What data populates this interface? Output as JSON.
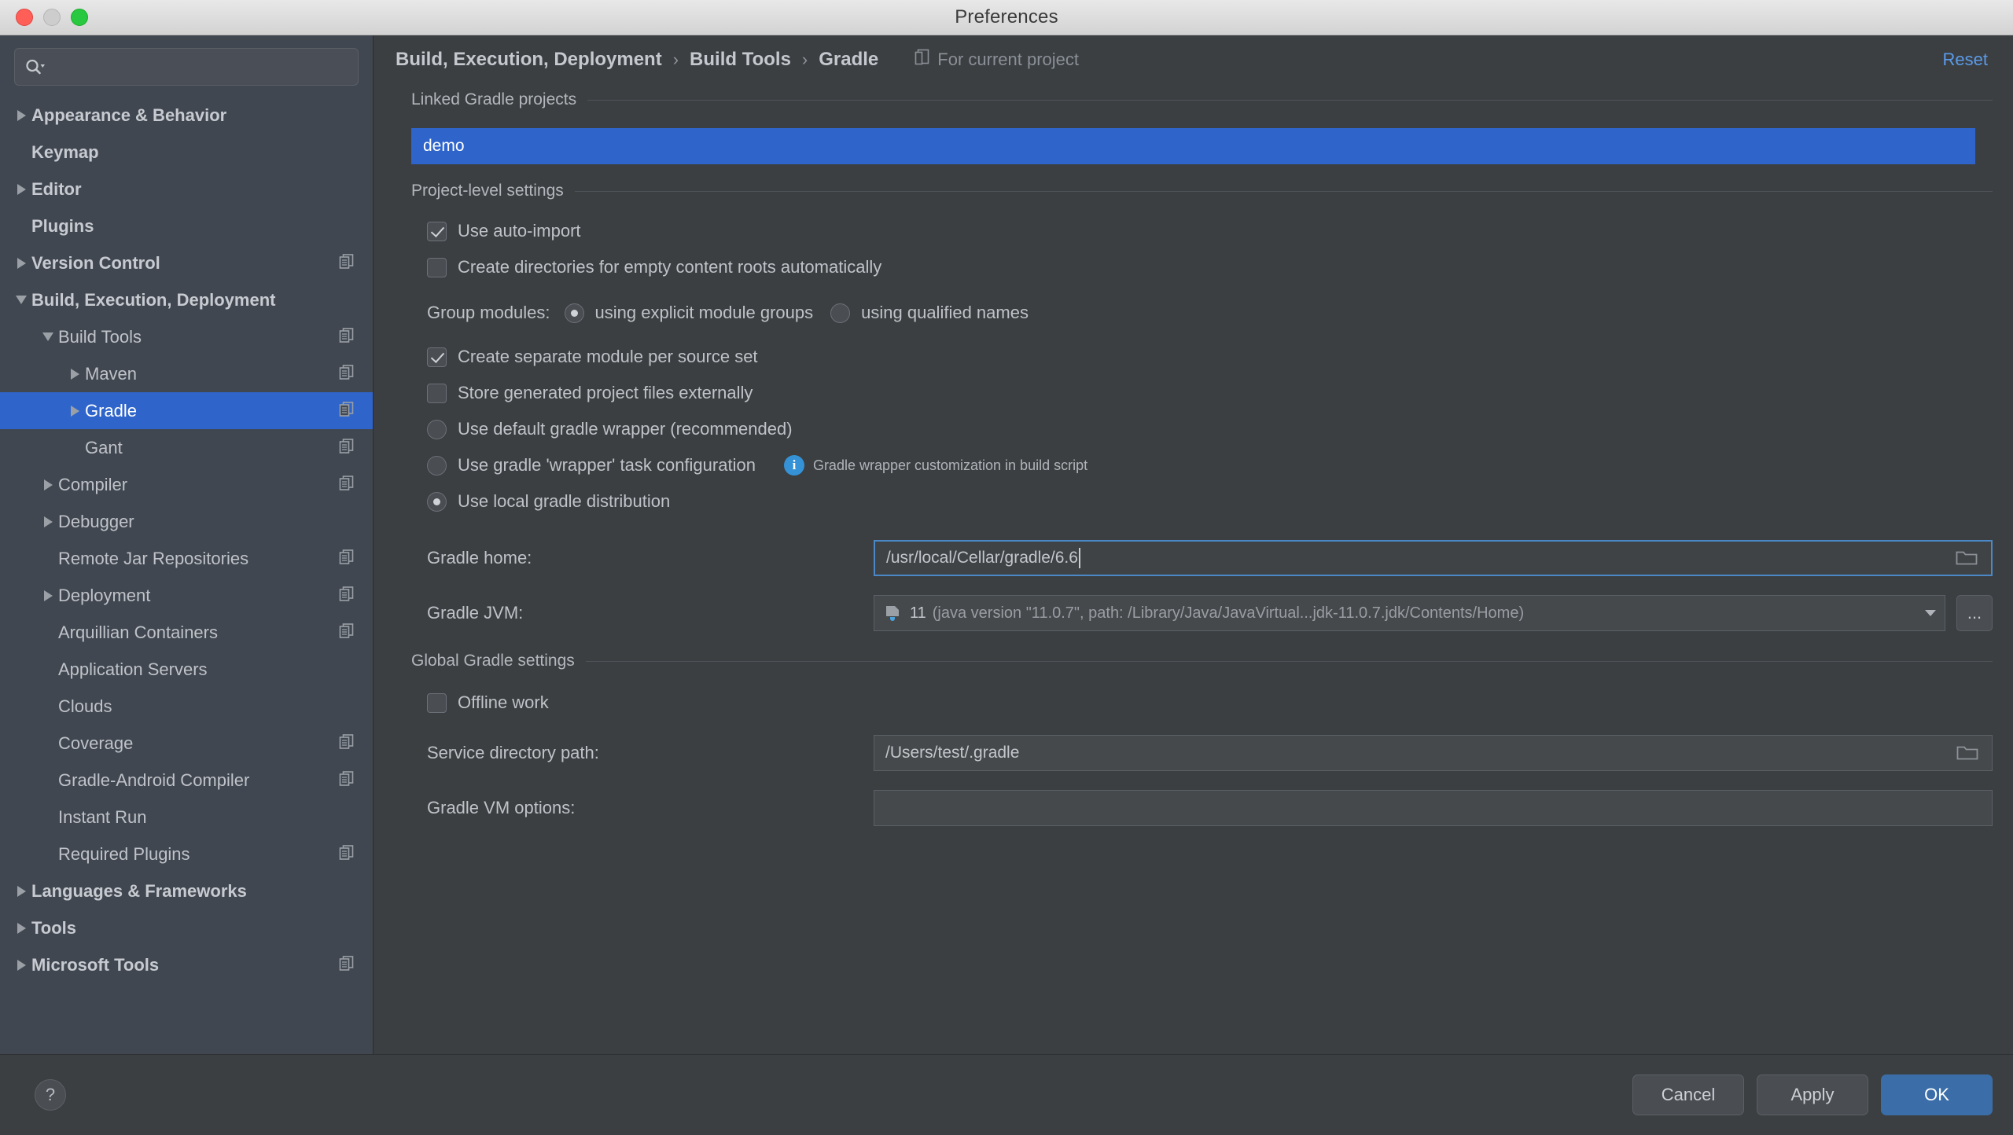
{
  "window": {
    "title": "Preferences",
    "traffic_lights": [
      "close-red",
      "minimize-yellow",
      "zoom-green"
    ]
  },
  "sidebar": {
    "search": {
      "value": "",
      "placeholder": ""
    },
    "items": [
      {
        "label": "Appearance & Behavior",
        "depth": 0,
        "twisty": "right",
        "bold": true,
        "copy": false,
        "selected": false
      },
      {
        "label": "Keymap",
        "depth": 0,
        "twisty": "none",
        "bold": true,
        "copy": false,
        "selected": false
      },
      {
        "label": "Editor",
        "depth": 0,
        "twisty": "right",
        "bold": true,
        "copy": false,
        "selected": false
      },
      {
        "label": "Plugins",
        "depth": 0,
        "twisty": "none",
        "bold": true,
        "copy": false,
        "selected": false
      },
      {
        "label": "Version Control",
        "depth": 0,
        "twisty": "right",
        "bold": true,
        "copy": true,
        "selected": false
      },
      {
        "label": "Build, Execution, Deployment",
        "depth": 0,
        "twisty": "down",
        "bold": true,
        "copy": false,
        "selected": false
      },
      {
        "label": "Build Tools",
        "depth": 1,
        "twisty": "down",
        "bold": false,
        "copy": true,
        "selected": false
      },
      {
        "label": "Maven",
        "depth": 2,
        "twisty": "right",
        "bold": false,
        "copy": true,
        "selected": false
      },
      {
        "label": "Gradle",
        "depth": 2,
        "twisty": "right",
        "bold": false,
        "copy": true,
        "selected": true
      },
      {
        "label": "Gant",
        "depth": 2,
        "twisty": "none",
        "bold": false,
        "copy": true,
        "selected": false
      },
      {
        "label": "Compiler",
        "depth": 1,
        "twisty": "right",
        "bold": false,
        "copy": true,
        "selected": false
      },
      {
        "label": "Debugger",
        "depth": 1,
        "twisty": "right",
        "bold": false,
        "copy": false,
        "selected": false
      },
      {
        "label": "Remote Jar Repositories",
        "depth": 1,
        "twisty": "none",
        "bold": false,
        "copy": true,
        "selected": false
      },
      {
        "label": "Deployment",
        "depth": 1,
        "twisty": "right",
        "bold": false,
        "copy": true,
        "selected": false
      },
      {
        "label": "Arquillian Containers",
        "depth": 1,
        "twisty": "none",
        "bold": false,
        "copy": true,
        "selected": false
      },
      {
        "label": "Application Servers",
        "depth": 1,
        "twisty": "none",
        "bold": false,
        "copy": false,
        "selected": false
      },
      {
        "label": "Clouds",
        "depth": 1,
        "twisty": "none",
        "bold": false,
        "copy": false,
        "selected": false
      },
      {
        "label": "Coverage",
        "depth": 1,
        "twisty": "none",
        "bold": false,
        "copy": true,
        "selected": false
      },
      {
        "label": "Gradle-Android Compiler",
        "depth": 1,
        "twisty": "none",
        "bold": false,
        "copy": true,
        "selected": false
      },
      {
        "label": "Instant Run",
        "depth": 1,
        "twisty": "none",
        "bold": false,
        "copy": false,
        "selected": false
      },
      {
        "label": "Required Plugins",
        "depth": 1,
        "twisty": "none",
        "bold": false,
        "copy": true,
        "selected": false
      },
      {
        "label": "Languages & Frameworks",
        "depth": 0,
        "twisty": "right",
        "bold": true,
        "copy": false,
        "selected": false
      },
      {
        "label": "Tools",
        "depth": 0,
        "twisty": "right",
        "bold": true,
        "copy": false,
        "selected": false
      },
      {
        "label": "Microsoft Tools",
        "depth": 0,
        "twisty": "right",
        "bold": true,
        "copy": true,
        "selected": false
      }
    ]
  },
  "content": {
    "breadcrumb": {
      "parts": [
        "Build, Execution, Deployment",
        "Build Tools",
        "Gradle"
      ],
      "separator": "›",
      "scope_label": "For current project"
    },
    "reset_label": "Reset",
    "linked_projects": {
      "group_title": "Linked Gradle projects",
      "entries": [
        "demo"
      ]
    },
    "project_level": {
      "group_title": "Project-level settings",
      "use_auto_import": {
        "label": "Use auto-import",
        "checked": true
      },
      "create_directories": {
        "label": "Create directories for empty content roots automatically",
        "checked": false
      },
      "group_modules": {
        "label": "Group modules:",
        "options": [
          {
            "label": "using explicit module groups",
            "selected": true
          },
          {
            "label": "using qualified names",
            "selected": false
          }
        ]
      },
      "create_separate_module": {
        "label": "Create separate module per source set",
        "checked": true
      },
      "store_generated": {
        "label": "Store generated project files externally",
        "checked": false
      },
      "distribution_options": [
        {
          "label": "Use default gradle wrapper (recommended)",
          "selected": false
        },
        {
          "label": "Use gradle 'wrapper' task configuration",
          "selected": false,
          "hint": "Gradle wrapper customization in build script"
        },
        {
          "label": "Use local gradle distribution",
          "selected": true
        }
      ],
      "gradle_home": {
        "label": "Gradle home:",
        "value": "/usr/local/Cellar/gradle/6.6",
        "focused": true
      },
      "gradle_jvm": {
        "label": "Gradle JVM:",
        "version": "11",
        "detail": "(java version \"11.0.7\", path: /Library/Java/JavaVirtual...jdk-11.0.7.jdk/Contents/Home)",
        "more_button": "..."
      }
    },
    "global_settings": {
      "group_title": "Global Gradle settings",
      "offline_work": {
        "label": "Offline work",
        "checked": false
      },
      "service_directory": {
        "label": "Service directory path:",
        "value": "/Users/test/.gradle"
      },
      "vm_options": {
        "label": "Gradle VM options:",
        "value": ""
      }
    }
  },
  "footer": {
    "help_label": "?",
    "buttons": [
      {
        "label": "Cancel",
        "primary": false
      },
      {
        "label": "Apply",
        "primary": false
      },
      {
        "label": "OK",
        "primary": true
      }
    ]
  },
  "colors": {
    "accent_blue": "#2f65ca",
    "link_blue": "#5a9bea",
    "primary_button": "#3b6ea8",
    "info_blue": "#3592d6",
    "panel_bg": "#3c3f41",
    "sidebar_bg": "#414750"
  }
}
